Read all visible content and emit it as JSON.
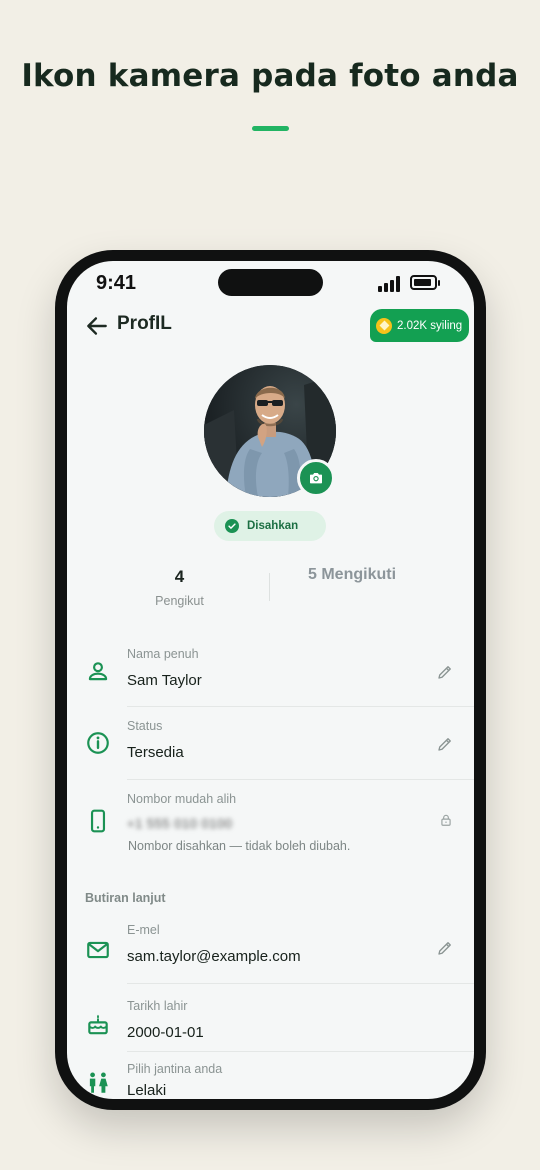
{
  "headline": "Ikon kamera pada foto anda",
  "colors": {
    "accent": "#1b9254",
    "badge": "#13a052",
    "coin": "#f6c21b",
    "background": "#f2efe6"
  },
  "statusbar": {
    "time": "9:41"
  },
  "header": {
    "title": "ProfIL",
    "back_icon": "arrow-left-icon",
    "coin_badge": "2.02K syiling"
  },
  "profile": {
    "verified_label": "Disahkan",
    "camera_icon": "camera-icon"
  },
  "stats": {
    "followers_count": "4",
    "followers_label": "Pengikut",
    "following": "5 Mengikuti"
  },
  "fields": {
    "name": {
      "label": "Nama penuh",
      "value": "Sam Taylor"
    },
    "status": {
      "label": "Status",
      "value": "Tersedia"
    },
    "phone": {
      "label": "Nombor mudah alih",
      "value": "+1 555 010 0100",
      "note": "Nombor disahkan — tidak boleh diubah."
    }
  },
  "more_details": {
    "heading": "Butiran lanjut",
    "email": {
      "label": "E-mel",
      "value": "sam.taylor@example.com"
    },
    "birthdate": {
      "label": "Tarikh lahir",
      "value": "2000-01-01"
    },
    "gender": {
      "label": "Pilih jantina anda",
      "value": "Lelaki"
    }
  }
}
